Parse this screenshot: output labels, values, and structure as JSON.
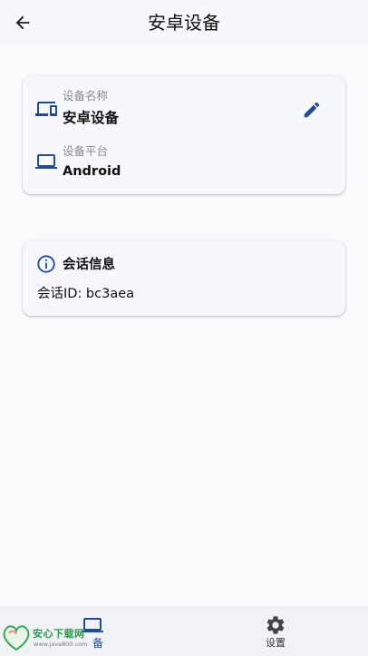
{
  "appbar": {
    "title": "安卓设备"
  },
  "device_card": {
    "name_label": "设备名称",
    "name_value": "安卓设备",
    "platform_label": "设备平台",
    "platform_value": "Android"
  },
  "session_card": {
    "title": "会话信息",
    "session_id": "会话ID: bc3aea"
  },
  "bottom_nav": {
    "items": [
      {
        "label": "备",
        "icon": "laptop-icon",
        "active": true
      },
      {
        "label": "设置",
        "icon": "gear-icon",
        "active": false
      }
    ]
  },
  "watermark": {
    "text": "安心下载网",
    "url": "www.java800.com"
  },
  "colors": {
    "accent": "#1f4b99",
    "background": "#fbfbfe",
    "card": "#f7f8fb"
  }
}
